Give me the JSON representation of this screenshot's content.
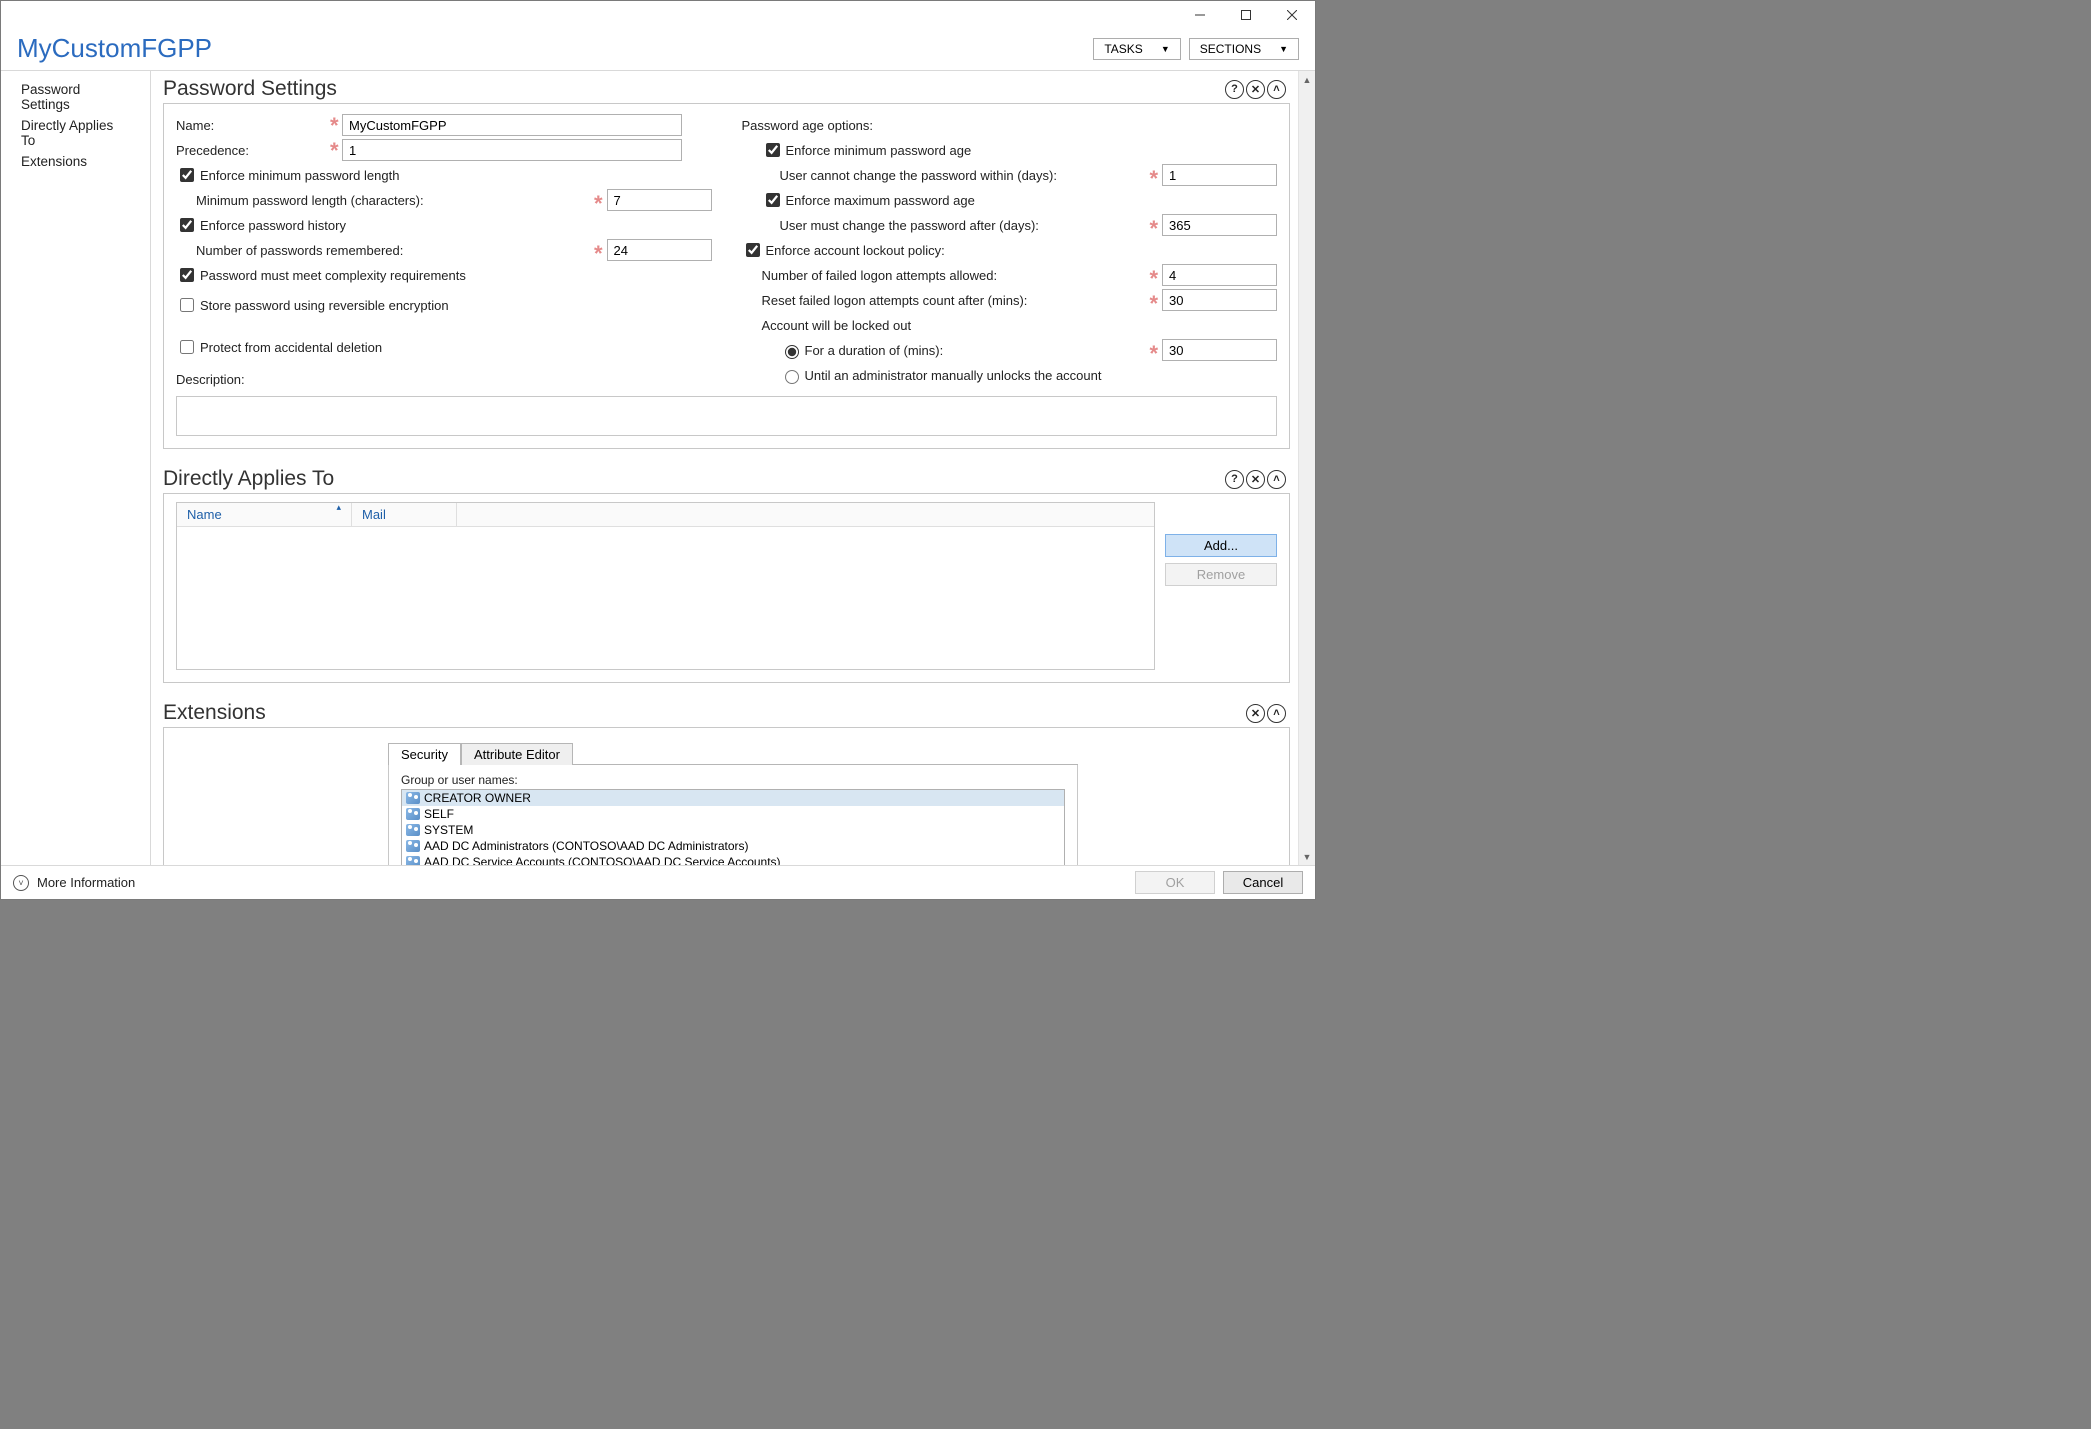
{
  "header": {
    "title": "MyCustomFGPP",
    "tasks_btn": "TASKS",
    "sections_btn": "SECTIONS"
  },
  "sidebar": {
    "items": [
      "Password Settings",
      "Directly Applies To",
      "Extensions"
    ]
  },
  "ps": {
    "title": "Password Settings",
    "name_lbl": "Name:",
    "name_val": "MyCustomFGPP",
    "prec_lbl": "Precedence:",
    "prec_val": "1",
    "enf_minlen": "Enforce minimum password length",
    "minlen_lbl": "Minimum password length (characters):",
    "minlen_val": "7",
    "enf_hist": "Enforce password history",
    "hist_lbl": "Number of passwords remembered:",
    "hist_val": "24",
    "complexity": "Password must meet complexity requirements",
    "reversible": "Store password using reversible encryption",
    "protect": "Protect from accidental deletion",
    "desc_lbl": "Description:",
    "age_head": "Password age options:",
    "enf_minage": "Enforce minimum password age",
    "minage_lbl": "User cannot change the password within (days):",
    "minage_val": "1",
    "enf_maxage": "Enforce maximum password age",
    "maxage_lbl": "User must change the password after (days):",
    "maxage_val": "365",
    "enf_lock": "Enforce account lockout policy:",
    "failcnt_lbl": "Number of failed logon attempts allowed:",
    "failcnt_val": "4",
    "reset_lbl": "Reset failed logon attempts count after (mins):",
    "reset_val": "30",
    "lock_head": "Account will be locked out",
    "dur_lbl": "For a duration of (mins):",
    "dur_val": "30",
    "until_lbl": "Until an administrator manually unlocks the account"
  },
  "dat": {
    "title": "Directly Applies To",
    "col_name": "Name",
    "col_mail": "Mail",
    "add_btn": "Add...",
    "remove_btn": "Remove"
  },
  "ext": {
    "title": "Extensions",
    "tab_sec": "Security",
    "tab_attr": "Attribute Editor",
    "grp_lbl": "Group or user names:",
    "users": [
      "CREATOR OWNER",
      "SELF",
      "SYSTEM",
      "AAD DC Administrators (CONTOSO\\AAD DC Administrators)",
      "AAD DC Service Accounts (CONTOSO\\AAD DC Service Accounts)"
    ]
  },
  "footer": {
    "more": "More Information",
    "ok": "OK",
    "cancel": "Cancel"
  }
}
